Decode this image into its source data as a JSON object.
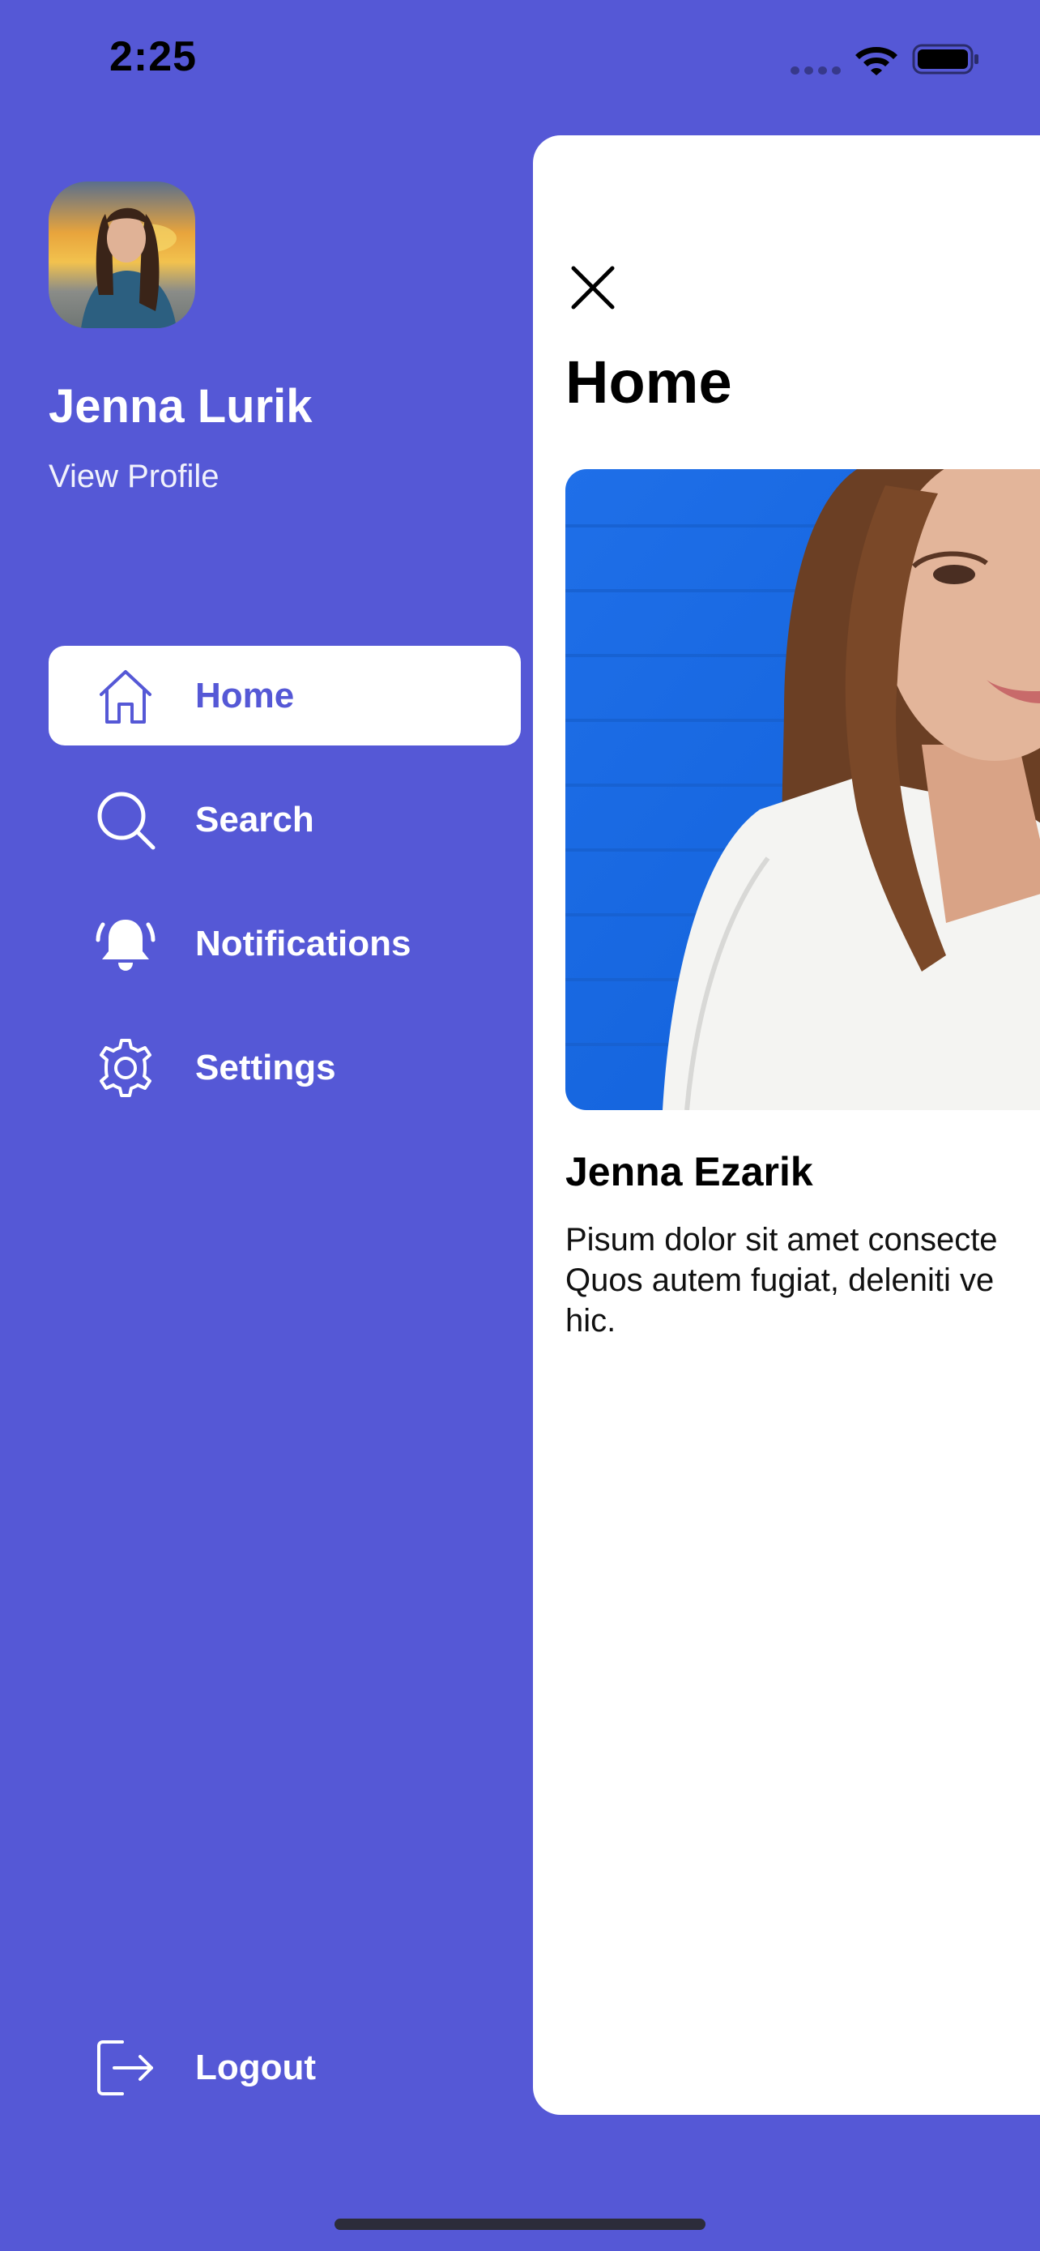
{
  "status_bar": {
    "time": "2:25",
    "icons": [
      "signal-icon",
      "wifi-icon",
      "battery-icon"
    ]
  },
  "drawer": {
    "avatar": "profile-photo",
    "user_name": "Jenna Lurik",
    "view_profile_label": "View Profile",
    "items": [
      {
        "label": "Home",
        "icon": "home-icon",
        "active": true
      },
      {
        "label": "Search",
        "icon": "search-icon",
        "active": false
      },
      {
        "label": "Notifications",
        "icon": "bell-icon",
        "active": false
      },
      {
        "label": "Settings",
        "icon": "gear-icon",
        "active": false
      }
    ],
    "logout_label": "Logout",
    "logout_icon": "logout-icon"
  },
  "content": {
    "close_icon": "close-icon",
    "title": "Home",
    "hero_image": "portrait-photo",
    "card_name": "Jenna Ezarik",
    "description_lines": [
      "Pisum dolor sit amet consecte",
      "Quos autem fugiat, deleniti ve",
      "hic."
    ]
  },
  "colors": {
    "brand": "#5558D6",
    "card_background": "#FFFFFF",
    "text_dark": "#000000"
  }
}
